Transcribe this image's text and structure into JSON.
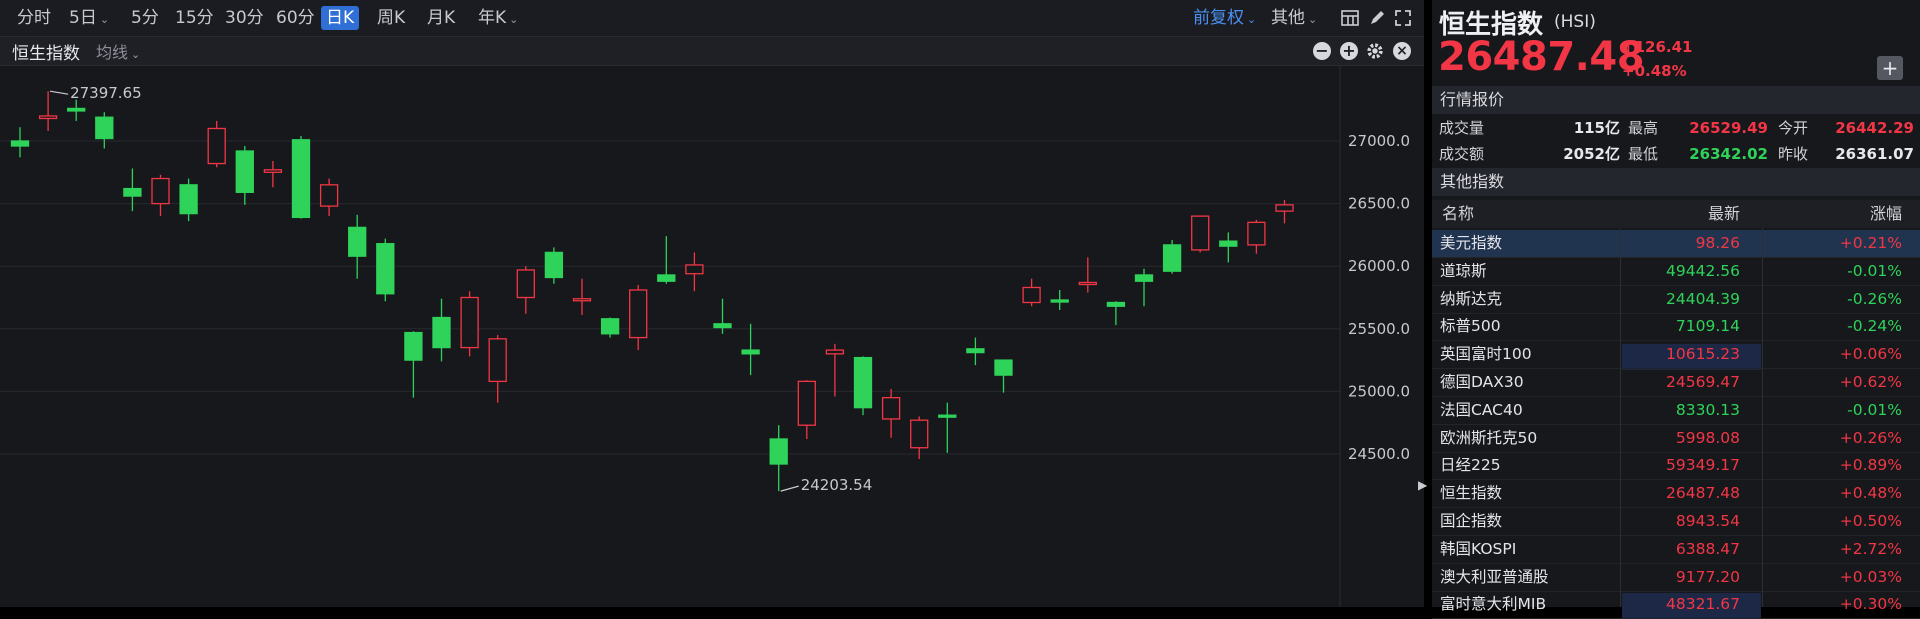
{
  "toolbar": {
    "periods": [
      "分时",
      "5日",
      "5分",
      "15分",
      "30分",
      "60分",
      "日K",
      "周K",
      "月K",
      "年K"
    ],
    "active": "日K",
    "adjust": "前复权",
    "other": "其他"
  },
  "subbar": {
    "title": "恒生指数",
    "ma": "均线"
  },
  "chart_data": {
    "type": "candlestick",
    "y_ticks": [
      "27000.0",
      "26500.0",
      "26000.0",
      "25500.0",
      "25000.0",
      "24500.0"
    ],
    "ylim": [
      24150,
      27550
    ],
    "high_label": "27397.65",
    "low_label": "24203.54",
    "candles": [
      {
        "o": 27000,
        "c": 26960,
        "h": 27110,
        "l": 26870
      },
      {
        "o": 27180,
        "c": 27200,
        "h": 27397.65,
        "l": 27080
      },
      {
        "o": 27260,
        "c": 27240,
        "h": 27330,
        "l": 27160
      },
      {
        "o": 27190,
        "c": 27020,
        "h": 27230,
        "l": 26940
      },
      {
        "o": 26620,
        "c": 26560,
        "h": 26780,
        "l": 26440
      },
      {
        "o": 26500,
        "c": 26700,
        "h": 26730,
        "l": 26400
      },
      {
        "o": 26650,
        "c": 26420,
        "h": 26700,
        "l": 26360
      },
      {
        "o": 26820,
        "c": 27100,
        "h": 27160,
        "l": 26790
      },
      {
        "o": 26920,
        "c": 26590,
        "h": 26960,
        "l": 26490
      },
      {
        "o": 26750,
        "c": 26770,
        "h": 26840,
        "l": 26630
      },
      {
        "o": 27010,
        "c": 26390,
        "h": 27040,
        "l": 26380
      },
      {
        "o": 26480,
        "c": 26650,
        "h": 26700,
        "l": 26400
      },
      {
        "o": 26310,
        "c": 26080,
        "h": 26410,
        "l": 25900
      },
      {
        "o": 26180,
        "c": 25780,
        "h": 26220,
        "l": 25720
      },
      {
        "o": 25470,
        "c": 25250,
        "h": 25480,
        "l": 24950
      },
      {
        "o": 25590,
        "c": 25350,
        "h": 25740,
        "l": 25240
      },
      {
        "o": 25350,
        "c": 25750,
        "h": 25800,
        "l": 25280
      },
      {
        "o": 25080,
        "c": 25420,
        "h": 25450,
        "l": 24910
      },
      {
        "o": 25750,
        "c": 25970,
        "h": 26000,
        "l": 25620
      },
      {
        "o": 26110,
        "c": 25910,
        "h": 26150,
        "l": 25860
      },
      {
        "o": 25730,
        "c": 25740,
        "h": 25900,
        "l": 25610
      },
      {
        "o": 25580,
        "c": 25460,
        "h": 25590,
        "l": 25430
      },
      {
        "o": 25430,
        "c": 25810,
        "h": 25850,
        "l": 25330
      },
      {
        "o": 25930,
        "c": 25880,
        "h": 26240,
        "l": 25860
      },
      {
        "o": 25940,
        "c": 26010,
        "h": 26110,
        "l": 25800
      },
      {
        "o": 25540,
        "c": 25510,
        "h": 25740,
        "l": 25460
      },
      {
        "o": 25330,
        "c": 25300,
        "h": 25540,
        "l": 25130
      },
      {
        "o": 24620,
        "c": 24420,
        "h": 24730,
        "l": 24203.54
      },
      {
        "o": 24730,
        "c": 25080,
        "h": 25090,
        "l": 24620
      },
      {
        "o": 25300,
        "c": 25330,
        "h": 25380,
        "l": 24960
      },
      {
        "o": 25270,
        "c": 24870,
        "h": 25280,
        "l": 24810
      },
      {
        "o": 24780,
        "c": 24950,
        "h": 25020,
        "l": 24630
      },
      {
        "o": 24550,
        "c": 24770,
        "h": 24800,
        "l": 24460
      },
      {
        "o": 24810,
        "c": 24800,
        "h": 24910,
        "l": 24510
      },
      {
        "o": 25340,
        "c": 25310,
        "h": 25430,
        "l": 25210
      },
      {
        "o": 25250,
        "c": 25130,
        "h": 25250,
        "l": 24990
      },
      {
        "o": 25710,
        "c": 25830,
        "h": 25900,
        "l": 25680
      },
      {
        "o": 25730,
        "c": 25720,
        "h": 25810,
        "l": 25650
      },
      {
        "o": 25860,
        "c": 25870,
        "h": 26070,
        "l": 25790
      },
      {
        "o": 25710,
        "c": 25680,
        "h": 25720,
        "l": 25530
      },
      {
        "o": 25930,
        "c": 25880,
        "h": 25980,
        "l": 25680
      },
      {
        "o": 26170,
        "c": 25960,
        "h": 26210,
        "l": 25940
      },
      {
        "o": 26130,
        "c": 26400,
        "h": 26400,
        "l": 26110
      },
      {
        "o": 26200,
        "c": 26160,
        "h": 26270,
        "l": 26030
      },
      {
        "o": 26170,
        "c": 26350,
        "h": 26370,
        "l": 26100
      },
      {
        "o": 26440,
        "c": 26490,
        "h": 26529.49,
        "l": 26342.02
      }
    ]
  },
  "quote": {
    "name": "恒生指数",
    "code": "(HSI)",
    "price": "26487.48",
    "change": "126.41",
    "pct": "+0.48%",
    "section1": "行情报价",
    "volume_label": "成交量",
    "volume": "115亿",
    "turnover_label": "成交额",
    "turnover": "2052亿",
    "high_label": "最高",
    "high": "26529.49",
    "low_label": "最低",
    "low": "26342.02",
    "open_label": "今开",
    "open": "26442.29",
    "prev_label": "昨收",
    "prev": "26361.07",
    "section2": "其他指数"
  },
  "table": {
    "headers": [
      "名称",
      "最新",
      "涨幅"
    ],
    "rows": [
      {
        "name": "美元指数",
        "last": "98.26",
        "chg": "+0.21%",
        "last_color": "red",
        "chg_color": "red"
      },
      {
        "name": "道琼斯",
        "last": "49442.56",
        "chg": "-0.01%",
        "last_color": "green",
        "chg_color": "green"
      },
      {
        "name": "纳斯达克",
        "last": "24404.39",
        "chg": "-0.26%",
        "last_color": "green",
        "chg_color": "green"
      },
      {
        "name": "标普500",
        "last": "7109.14",
        "chg": "-0.24%",
        "last_color": "green",
        "chg_color": "green"
      },
      {
        "name": "英国富时100",
        "last": "10615.23",
        "chg": "+0.06%",
        "last_color": "red",
        "chg_color": "red"
      },
      {
        "name": "德国DAX30",
        "last": "24569.47",
        "chg": "+0.62%",
        "last_color": "red",
        "chg_color": "red"
      },
      {
        "name": "法国CAC40",
        "last": "8330.13",
        "chg": "-0.01%",
        "last_color": "green",
        "chg_color": "green"
      },
      {
        "name": "欧洲斯托克50",
        "last": "5998.08",
        "chg": "+0.26%",
        "last_color": "red",
        "chg_color": "red"
      },
      {
        "name": "日经225",
        "last": "59349.17",
        "chg": "+0.89%",
        "last_color": "red",
        "chg_color": "red"
      },
      {
        "name": "恒生指数",
        "last": "26487.48",
        "chg": "+0.48%",
        "last_color": "red",
        "chg_color": "red"
      },
      {
        "name": "国企指数",
        "last": "8943.54",
        "chg": "+0.50%",
        "last_color": "red",
        "chg_color": "red"
      },
      {
        "name": "韩国KOSPI",
        "last": "6388.47",
        "chg": "+2.72%",
        "last_color": "red",
        "chg_color": "red"
      },
      {
        "name": "澳大利亚普通股",
        "last": "9177.20",
        "chg": "+0.03%",
        "last_color": "red",
        "chg_color": "red"
      },
      {
        "name": "富时意大利MIB",
        "last": "48321.67",
        "chg": "+0.30%",
        "last_color": "red",
        "chg_color": "red"
      }
    ]
  }
}
